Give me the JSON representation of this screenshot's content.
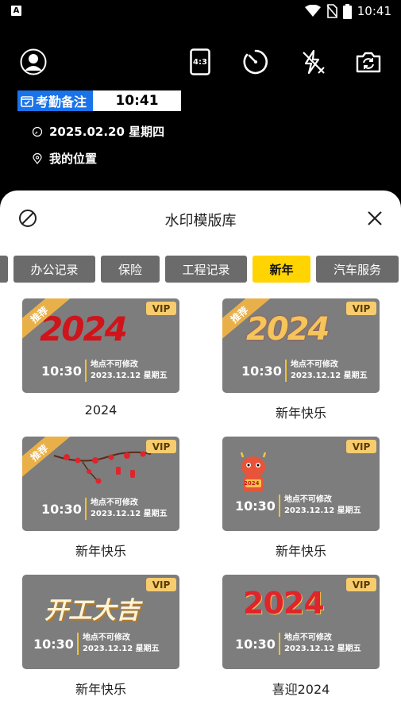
{
  "status_bar": {
    "time": "10:41",
    "left_badge": "A",
    "icons": [
      "wifi-icon",
      "sim-off-icon",
      "battery-icon"
    ]
  },
  "camera_toolbar": {
    "icons": [
      "avatar-icon",
      "aspect-ratio-icon",
      "timer-icon",
      "flash-off-icon",
      "switch-camera-icon"
    ],
    "aspect_ratio_label": "4:3"
  },
  "watermark_preview": {
    "tag_label": "考勤备注",
    "time": "10:41",
    "date_line": "2025.02.20 星期四",
    "location_line": "我的位置"
  },
  "sheet": {
    "title": "水印模版库",
    "tabs": [
      {
        "label": "",
        "active": false
      },
      {
        "label": "办公记录",
        "active": false
      },
      {
        "label": "保险",
        "active": false
      },
      {
        "label": "工程记录",
        "active": false
      },
      {
        "label": "新年",
        "active": true
      },
      {
        "label": "汽车服务",
        "active": false
      }
    ],
    "templates": [
      {
        "label": "2024",
        "vip": "VIP",
        "ribbon": "推荐",
        "art": "2024",
        "time": "10:30",
        "line1": "地点不可修改",
        "line2": "2023.12.12  星期五"
      },
      {
        "label": "新年快乐",
        "vip": "VIP",
        "ribbon": "推荐",
        "art": "2024",
        "time": "10:30",
        "line1": "地点不可修改",
        "line2": "2023.12.12  星期五"
      },
      {
        "label": "新年快乐",
        "vip": "VIP",
        "ribbon": "推荐",
        "art": "",
        "time": "10:30",
        "line1": "地点不可修改",
        "line2": "2023.12.12  星期五"
      },
      {
        "label": "新年快乐",
        "vip": "VIP",
        "ribbon": "",
        "art": "2024",
        "time": "10:30",
        "line1": "地点不可修改",
        "line2": "2023.12.12  星期五"
      },
      {
        "label": "新年快乐",
        "vip": "VIP",
        "ribbon": "",
        "art": "开工大吉",
        "time": "10:30",
        "line1": "地点不可修改",
        "line2": "2023.12.12  星期五"
      },
      {
        "label": "喜迎2024",
        "vip": "VIP",
        "ribbon": "",
        "art": "2024",
        "time": "10:30",
        "line1": "地点不可修改",
        "line2": "2023.12.12  星期五"
      }
    ]
  },
  "colors": {
    "accent_yellow": "#ffd400",
    "tag_blue": "#1a73e8",
    "tab_gray": "#6b6b6b",
    "card_gray": "#7d7d7d",
    "vip_gold": "#f6cc6e"
  }
}
